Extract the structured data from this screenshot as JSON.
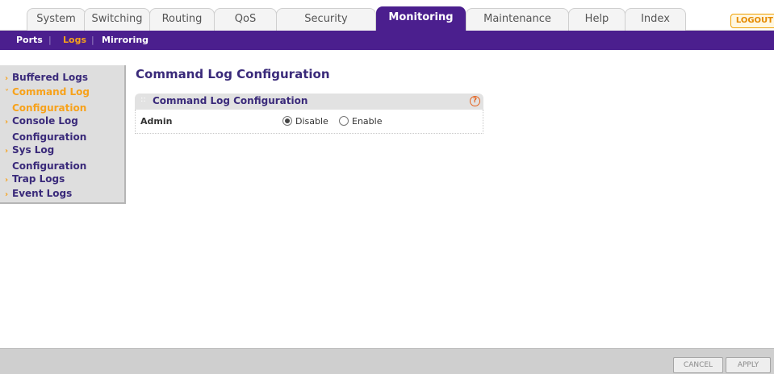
{
  "tabs": [
    {
      "label": "System",
      "active": false
    },
    {
      "label": "Switching",
      "active": false
    },
    {
      "label": "Routing",
      "active": false
    },
    {
      "label": "QoS",
      "active": false
    },
    {
      "label": "Security",
      "active": false
    },
    {
      "label": "Monitoring",
      "active": true
    },
    {
      "label": "Maintenance",
      "active": false
    },
    {
      "label": "Help",
      "active": false
    },
    {
      "label": "Index",
      "active": false
    }
  ],
  "logout_label": "LOGOUT",
  "submenu": [
    {
      "label": "Ports",
      "active": false
    },
    {
      "label": "Logs",
      "active": true
    },
    {
      "label": "Mirroring",
      "active": false
    }
  ],
  "submenu_separator": "|",
  "leftnav": [
    {
      "lines": [
        "Buffered Logs"
      ],
      "active": false
    },
    {
      "lines": [
        "Command Log",
        "Configuration"
      ],
      "active": true
    },
    {
      "lines": [
        "Console Log",
        "Configuration"
      ],
      "active": false
    },
    {
      "lines": [
        "Sys Log",
        "Configuration"
      ],
      "active": false
    },
    {
      "lines": [
        "Trap Logs"
      ],
      "active": false
    },
    {
      "lines": [
        "Event Logs"
      ],
      "active": false
    }
  ],
  "page_title": "Command Log Configuration",
  "panel": {
    "title": "Command Log Configuration",
    "help_glyph": "?",
    "grip_glyph": "::",
    "row_label": "Admin",
    "options": [
      {
        "label": "Disable",
        "checked": true
      },
      {
        "label": "Enable",
        "checked": false
      }
    ]
  },
  "buttons": {
    "cancel": "CANCEL",
    "apply": "APPLY"
  },
  "icons": {
    "nav_arrow_collapsed": "›",
    "nav_arrow_expanded": "˅"
  },
  "colors": {
    "brand_purple": "#4b1f8e",
    "accent_orange": "#f7a21b",
    "text_purple": "#3a2a7a"
  }
}
